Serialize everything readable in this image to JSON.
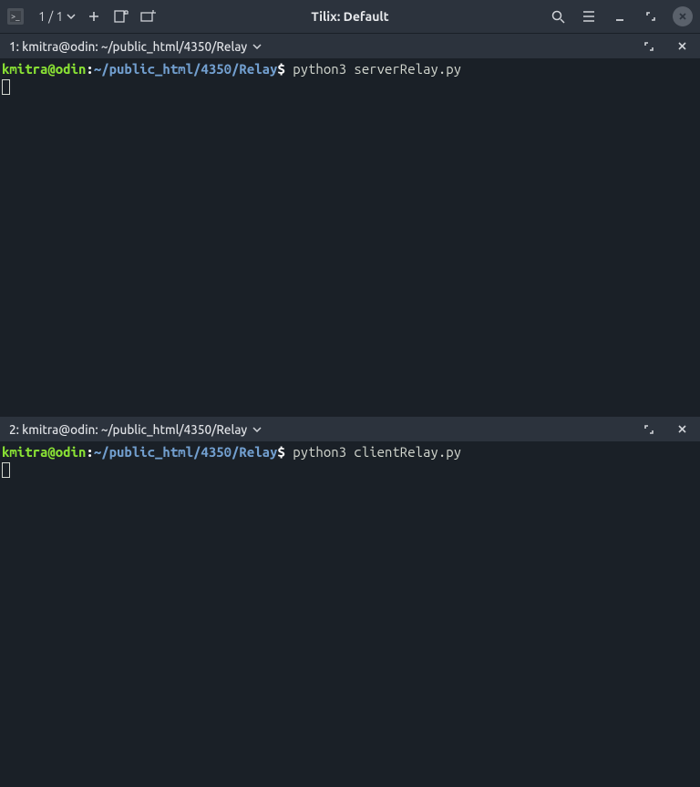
{
  "titlebar": {
    "session_label": "1 / 1",
    "title": "Tilix: Default"
  },
  "panes": [
    {
      "header_title": "1: kmitra@odin: ~/public_html/4350/Relay",
      "prompt_user": "kmitra@odin",
      "prompt_colon": ":",
      "prompt_path": "~/public_html/4350/Relay",
      "prompt_symbol": "$",
      "command": "python3 serverRelay.py"
    },
    {
      "header_title": "2: kmitra@odin: ~/public_html/4350/Relay",
      "prompt_user": "kmitra@odin",
      "prompt_colon": ":",
      "prompt_path": "~/public_html/4350/Relay",
      "prompt_symbol": "$",
      "command": "python3 clientRelay.py"
    }
  ]
}
